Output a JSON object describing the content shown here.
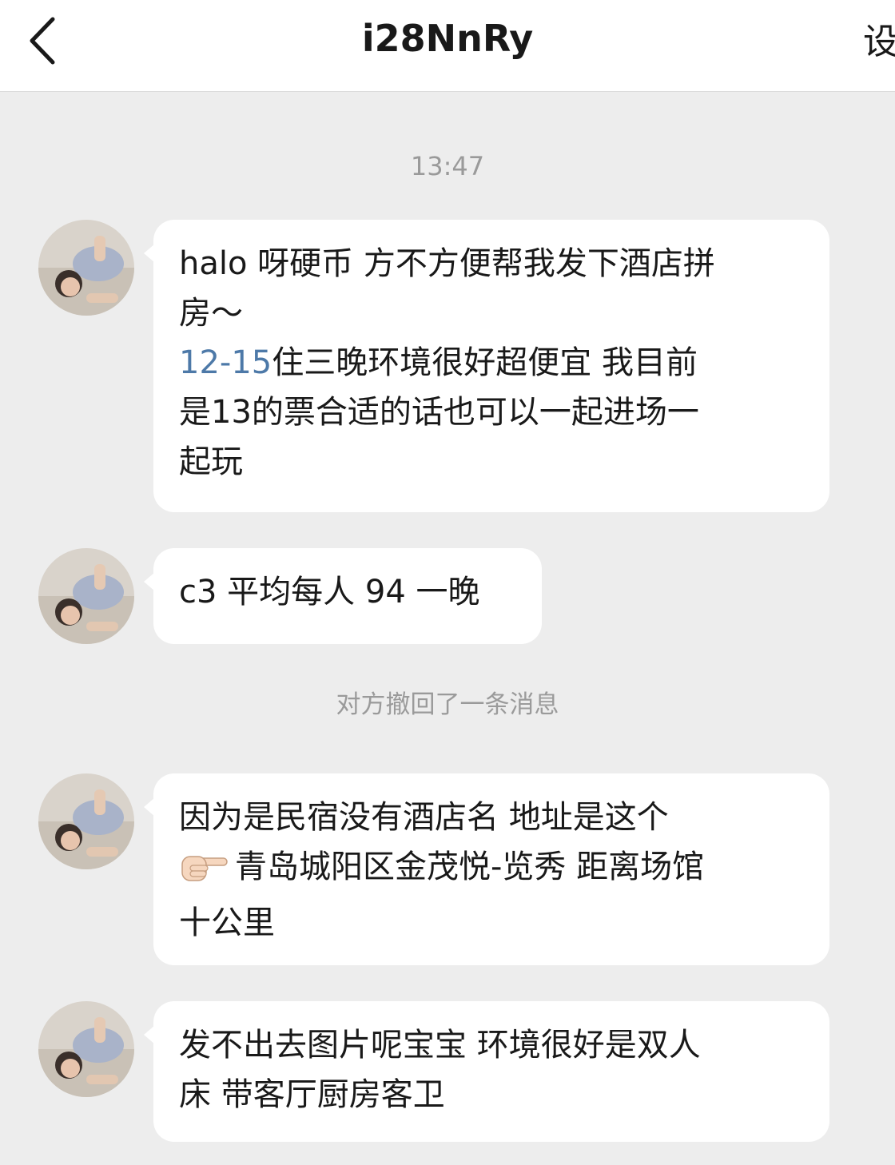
{
  "header": {
    "title": "i28NnRy",
    "right_label": "设"
  },
  "chat": {
    "timestamp": "13:47",
    "recall_notice": "对方撤回了一条消息",
    "messages": [
      {
        "line1": "halo 呀硬币 方不方便帮我发下酒店拼",
        "line2": "房～",
        "date_link": "12-15",
        "line3": "住三晚环境很好超便宜 我目前",
        "line4": "是13的票合适的话也可以一起进场一",
        "line5": "起玩"
      },
      {
        "text": "c3 平均每人 94 一晚"
      },
      {
        "line1": "因为是民宿没有酒店名 地址是这个",
        "line2": "青岛城阳区金茂悦-览秀 距离场馆",
        "line3": "十公里"
      },
      {
        "line1": "发不出去图片呢宝宝 环境很好是双人",
        "line2": "床 带客厅厨房客卫"
      }
    ]
  },
  "icons": {
    "back": "chevron-left-icon",
    "avatar": "avatar",
    "pointing": "backhand-index-pointing-right-icon"
  }
}
